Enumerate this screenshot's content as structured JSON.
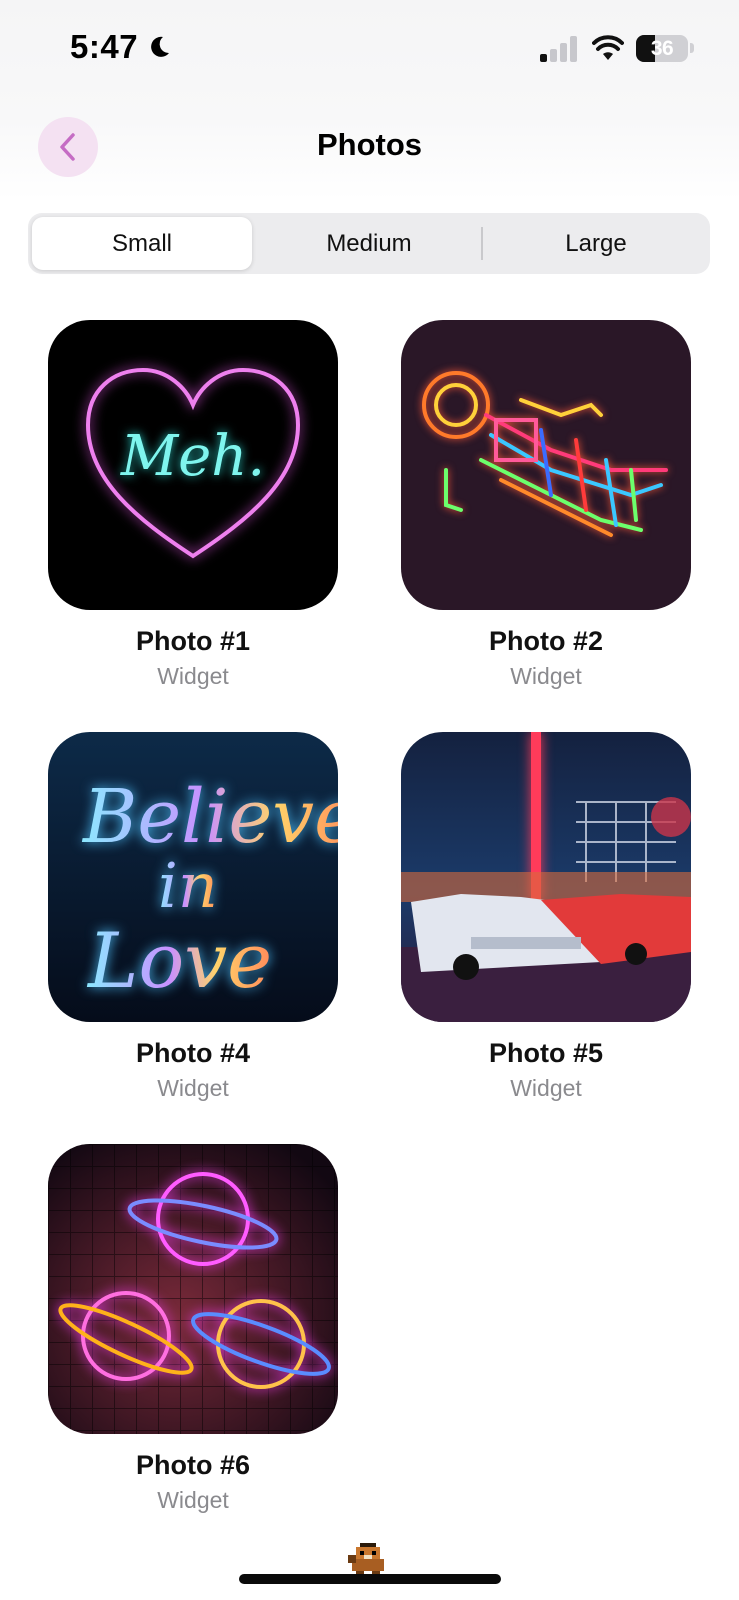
{
  "status_bar": {
    "time": "5:47",
    "battery": "36",
    "icons": [
      "moon-icon",
      "cellular-signal-icon",
      "wifi-icon",
      "battery-icon"
    ]
  },
  "nav": {
    "title": "Photos",
    "back_icon": "chevron-left-icon",
    "accent_color": "#c56cc4",
    "back_bg": "#f4e1f2"
  },
  "segments": {
    "selected": "Small",
    "options": [
      "Small",
      "Medium",
      "Large"
    ]
  },
  "photos": [
    {
      "title": "Photo #1",
      "subtitle": "Widget",
      "image": "neon heart sign reading Meh."
    },
    {
      "title": "Photo #2",
      "subtitle": "Widget",
      "image": "neon astronaut floating"
    },
    {
      "title": "Photo #4",
      "subtitle": "Widget",
      "image": "neon script sign"
    },
    {
      "title": "Photo #5",
      "subtitle": "Widget",
      "image": "classic cars at night carnival"
    },
    {
      "title": "Photo #6",
      "subtitle": "Widget",
      "image": "neon planets with rings"
    }
  ],
  "photo_text": {
    "meh": "Meh.",
    "believe": "Believe",
    "in": "in",
    "love": "Love"
  }
}
